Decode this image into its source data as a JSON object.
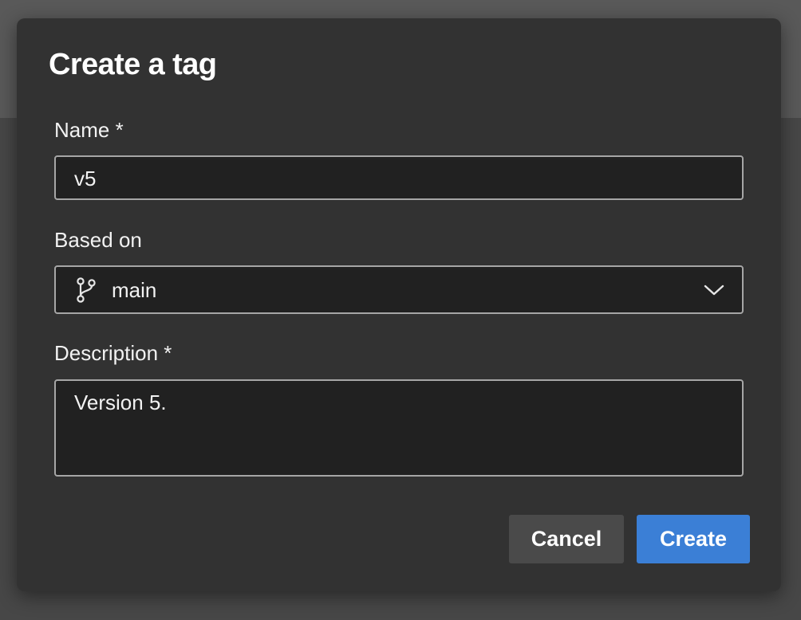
{
  "dialog": {
    "title": "Create a tag",
    "name": {
      "label": "Name *",
      "value": "v5"
    },
    "based_on": {
      "label": "Based on",
      "value": "main",
      "icon": "git-branch-icon",
      "dropdown_icon": "chevron-down-icon"
    },
    "description": {
      "label": "Description *",
      "value": "Version 5."
    },
    "buttons": {
      "cancel": "Cancel",
      "create": "Create"
    }
  },
  "colors": {
    "dialog_bg": "#323232",
    "field_bg": "#212121",
    "field_border": "#a6a6a6",
    "primary_button": "#3b7fd6",
    "secondary_button": "#4a4a4a",
    "text": "#f2f2f2"
  }
}
